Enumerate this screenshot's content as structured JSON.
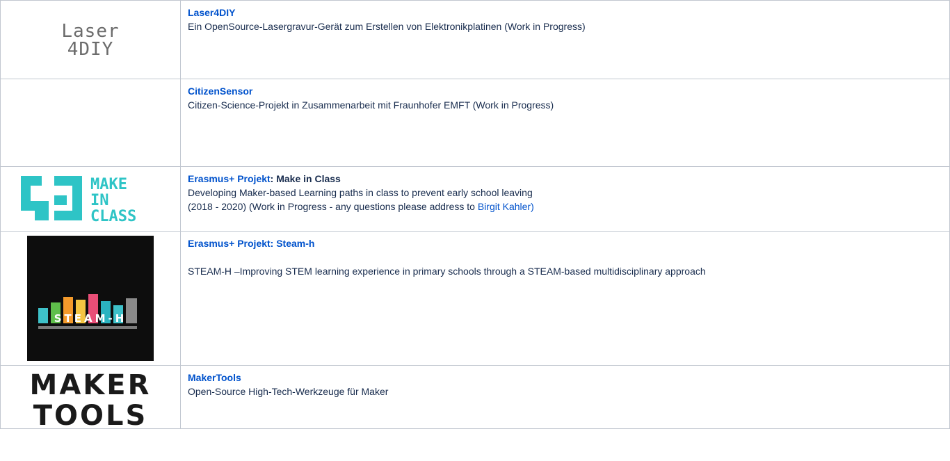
{
  "rows": [
    {
      "title": "Laser4DIY",
      "description": "Ein OpenSource-Lasergravur-Gerät zum Erstellen von Elektronikplatinen (Work in Progress)",
      "logo": {
        "line1": "Laser",
        "line2": "4DIY"
      }
    },
    {
      "title": "CitizenSensor",
      "description": "Citizen-Science-Projekt in Zusammenarbeit mit Fraunhofer EMFT (Work in Progress)"
    },
    {
      "title": "Erasmus+ Projekt",
      "title_suffix": ": Make in Class",
      "description_line1": "Developing Maker-based Learning paths in class to prevent early school leaving",
      "description_line2": "(2018 - 2020) (Work in Progress - any questions please address to ",
      "contact_link": "Birgit Kahler)",
      "logo": {
        "line1": "MAKE",
        "line2": "IN",
        "line3": "CLASS",
        "color": "#2ec4c6"
      }
    },
    {
      "title": "Erasmus+ Projekt: Steam-h",
      "description": "STEAM-H –Improving STEM learning experience in primary schools through a STEAM-based multidisciplinary approach",
      "logo": {
        "text": "STEAM-H"
      }
    },
    {
      "title": "MakerTools",
      "description": "Open-Source High-Tech-Werkzeuge für Maker",
      "logo": {
        "line1": "MAKER",
        "line2": "TOOLS"
      }
    }
  ],
  "colors": {
    "link": "#0052cc",
    "text": "#172b4d",
    "border": "#c1c7d0",
    "makeinclass": "#2ec4c6"
  }
}
